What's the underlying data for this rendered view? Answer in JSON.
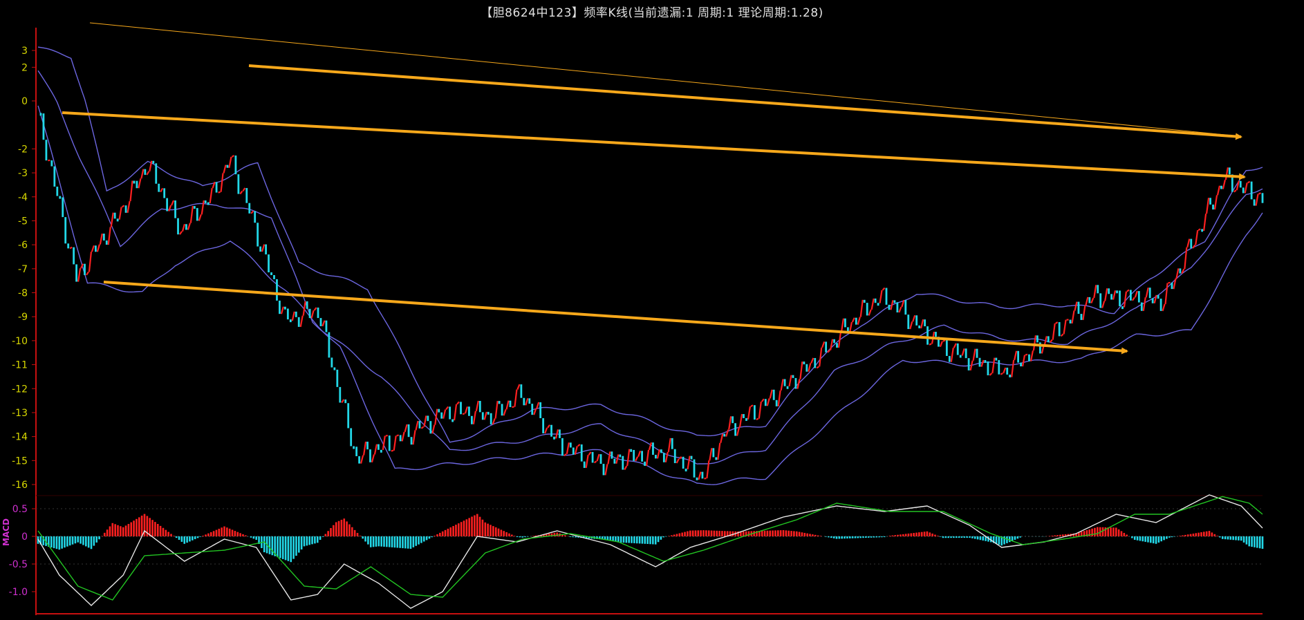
{
  "title": "【胆8624中123】频率K线(当前遗漏:1 周期:1 理论周期:1.28)",
  "colors": {
    "background": "#000000",
    "axis": "#c81010",
    "up_bar": "#ff2020",
    "down_bar": "#22d8e8",
    "band": "#6c66e0",
    "arrow": "#f7a81b",
    "macd_dif": "#e8e8e8",
    "macd_dea": "#22c422",
    "macd_label": "#d030d0",
    "tick_label": "#d8d800",
    "macd_tick_label": "#d030d0"
  },
  "chart_data": [
    {
      "type": "candlestick",
      "name": "main",
      "title": "【胆8624中123】频率K线(当前遗漏:1 周期:1 理论周期:1.28)",
      "y_ticks": [
        3,
        2,
        0,
        -2,
        -3,
        -4,
        -5,
        -6,
        -7,
        -8,
        -9,
        -10,
        -11,
        -12,
        -13,
        -14,
        -15,
        -16
      ],
      "ylim": [
        -16.5,
        3.6
      ],
      "grid": false,
      "bar_count": 310,
      "close_waypoints": [
        [
          0,
          -0.5
        ],
        [
          14,
          -7.4
        ],
        [
          30,
          -4.6
        ],
        [
          40,
          -2.6
        ],
        [
          52,
          -5.4
        ],
        [
          64,
          -3.8
        ],
        [
          70,
          -2.4
        ],
        [
          78,
          -4.9
        ],
        [
          90,
          -9.1
        ],
        [
          102,
          -8.7
        ],
        [
          116,
          -14.9
        ],
        [
          136,
          -13.8
        ],
        [
          150,
          -12.9
        ],
        [
          166,
          -13.1
        ],
        [
          176,
          -12.2
        ],
        [
          190,
          -14.3
        ],
        [
          204,
          -15.1
        ],
        [
          230,
          -14.6
        ],
        [
          242,
          -15.7
        ],
        [
          250,
          -13.8
        ],
        [
          266,
          -12.5
        ],
        [
          285,
          -10.6
        ],
        [
          298,
          -9.0
        ],
        [
          306,
          -8.2
        ],
        [
          310,
          -8.3
        ],
        [
          330,
          -10.3
        ],
        [
          352,
          -11.3
        ],
        [
          370,
          -9.7
        ],
        [
          385,
          -8.1
        ],
        [
          410,
          -8.3
        ],
        [
          432,
          -3.2
        ],
        [
          446,
          -4.1
        ]
      ],
      "bands": {
        "upper": [
          [
            0,
            3.2
          ],
          [
            12,
            2.6
          ],
          [
            25,
            -3.8
          ],
          [
            40,
            -2.6
          ],
          [
            60,
            -3.6
          ],
          [
            80,
            -2.6
          ],
          [
            95,
            -6.8
          ],
          [
            120,
            -7.8
          ],
          [
            150,
            -14.3
          ],
          [
            180,
            -12.9
          ],
          [
            205,
            -12.7
          ],
          [
            240,
            -14.0
          ],
          [
            265,
            -13.5
          ],
          [
            285,
            -10.7
          ],
          [
            300,
            -9.3
          ],
          [
            320,
            -8.0
          ],
          [
            350,
            -8.6
          ],
          [
            375,
            -8.5
          ],
          [
            392,
            -8.8
          ],
          [
            405,
            -7.4
          ],
          [
            425,
            -5.8
          ],
          [
            440,
            -2.9
          ],
          [
            446,
            -2.7
          ]
        ],
        "middle": [
          [
            0,
            1.8
          ],
          [
            15,
            -2.3
          ],
          [
            30,
            -6.0
          ],
          [
            45,
            -4.5
          ],
          [
            65,
            -4.3
          ],
          [
            85,
            -4.8
          ],
          [
            100,
            -9.2
          ],
          [
            125,
            -11.5
          ],
          [
            150,
            -14.6
          ],
          [
            180,
            -14.1
          ],
          [
            205,
            -13.5
          ],
          [
            240,
            -15.2
          ],
          [
            265,
            -14.5
          ],
          [
            290,
            -11.3
          ],
          [
            310,
            -10.2
          ],
          [
            330,
            -9.4
          ],
          [
            350,
            -9.9
          ],
          [
            375,
            -10.1
          ],
          [
            400,
            -8.7
          ],
          [
            420,
            -7.0
          ],
          [
            440,
            -3.9
          ],
          [
            446,
            -3.6
          ]
        ],
        "lower": [
          [
            0,
            -0.2
          ],
          [
            18,
            -7.6
          ],
          [
            38,
            -8.0
          ],
          [
            50,
            -6.8
          ],
          [
            70,
            -5.8
          ],
          [
            90,
            -7.9
          ],
          [
            110,
            -10.3
          ],
          [
            130,
            -15.4
          ],
          [
            155,
            -15.1
          ],
          [
            180,
            -14.8
          ],
          [
            205,
            -14.6
          ],
          [
            240,
            -16.0
          ],
          [
            265,
            -15.7
          ],
          [
            290,
            -13.2
          ],
          [
            315,
            -10.8
          ],
          [
            340,
            -11.0
          ],
          [
            360,
            -10.9
          ],
          [
            380,
            -10.8
          ],
          [
            400,
            -9.8
          ],
          [
            420,
            -9.6
          ],
          [
            440,
            -5.6
          ],
          [
            446,
            -4.6
          ]
        ]
      }
    },
    {
      "type": "line",
      "name": "MACD",
      "y_ticks": [
        0.5,
        0,
        -0.5,
        -1.0
      ],
      "y_tick_labels": [
        "0.5",
        "0",
        "-0.5",
        "-1.0"
      ],
      "ylim": [
        -1.4,
        0.85
      ],
      "series": [
        {
          "role": "dif",
          "points": [
            [
              0,
              -0.05
            ],
            [
              8,
              -0.7
            ],
            [
              20,
              -1.25
            ],
            [
              32,
              -0.7
            ],
            [
              40,
              0.1
            ],
            [
              55,
              -0.45
            ],
            [
              70,
              -0.05
            ],
            [
              82,
              -0.2
            ],
            [
              95,
              -1.15
            ],
            [
              105,
              -1.05
            ],
            [
              115,
              -0.5
            ],
            [
              128,
              -0.85
            ],
            [
              140,
              -1.3
            ],
            [
              152,
              -1.0
            ],
            [
              165,
              0.0
            ],
            [
              180,
              -0.1
            ],
            [
              195,
              0.1
            ],
            [
              215,
              -0.15
            ],
            [
              232,
              -0.55
            ],
            [
              245,
              -0.2
            ],
            [
              262,
              0.05
            ],
            [
              280,
              0.35
            ],
            [
              300,
              0.55
            ],
            [
              318,
              0.45
            ],
            [
              334,
              0.55
            ],
            [
              350,
              0.2
            ],
            [
              362,
              -0.2
            ],
            [
              378,
              -0.1
            ],
            [
              390,
              0.05
            ],
            [
              405,
              0.4
            ],
            [
              420,
              0.25
            ],
            [
              440,
              0.75
            ],
            [
              452,
              0.55
            ],
            [
              460,
              0.15
            ]
          ]
        },
        {
          "role": "dea",
          "points": [
            [
              0,
              0.1
            ],
            [
              15,
              -0.9
            ],
            [
              28,
              -1.15
            ],
            [
              40,
              -0.35
            ],
            [
              55,
              -0.3
            ],
            [
              70,
              -0.25
            ],
            [
              85,
              -0.1
            ],
            [
              100,
              -0.9
            ],
            [
              112,
              -0.95
            ],
            [
              125,
              -0.55
            ],
            [
              140,
              -1.05
            ],
            [
              152,
              -1.1
            ],
            [
              168,
              -0.3
            ],
            [
              182,
              -0.05
            ],
            [
              200,
              0.05
            ],
            [
              218,
              -0.1
            ],
            [
              235,
              -0.45
            ],
            [
              250,
              -0.25
            ],
            [
              265,
              0.0
            ],
            [
              285,
              0.3
            ],
            [
              300,
              0.6
            ],
            [
              320,
              0.45
            ],
            [
              340,
              0.45
            ],
            [
              358,
              0.05
            ],
            [
              370,
              -0.15
            ],
            [
              385,
              -0.05
            ],
            [
              398,
              0.05
            ],
            [
              412,
              0.4
            ],
            [
              425,
              0.4
            ],
            [
              445,
              0.72
            ],
            [
              455,
              0.6
            ],
            [
              460,
              0.4
            ]
          ]
        }
      ]
    }
  ],
  "macd_label": "MACD"
}
